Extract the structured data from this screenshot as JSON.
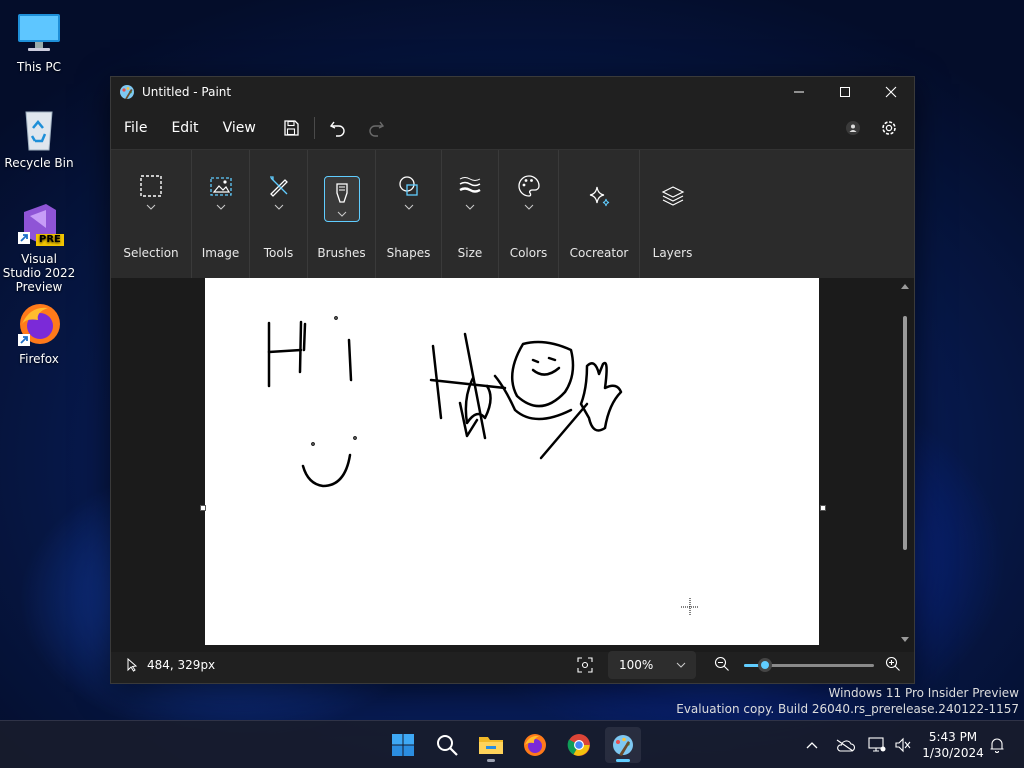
{
  "desktop": {
    "icons": [
      {
        "label": "This PC"
      },
      {
        "label": "Recycle Bin"
      },
      {
        "label": "Visual Studio 2022 Preview",
        "badge": "PRE"
      },
      {
        "label": "Firefox"
      }
    ]
  },
  "window": {
    "title": "Untitled - Paint"
  },
  "menu": {
    "items": [
      "File",
      "Edit",
      "View"
    ]
  },
  "ribbon": {
    "groups": [
      {
        "label": "Selection",
        "icon": "selection-icon"
      },
      {
        "label": "Image",
        "icon": "image-icon"
      },
      {
        "label": "Tools",
        "icon": "tools-icon"
      },
      {
        "label": "Brushes",
        "icon": "brush-icon"
      },
      {
        "label": "Shapes",
        "icon": "shapes-icon"
      },
      {
        "label": "Size",
        "icon": "size-icon"
      },
      {
        "label": "Colors",
        "icon": "palette-icon"
      },
      {
        "label": "Cocreator",
        "icon": "sparkle-icon"
      },
      {
        "label": "Layers",
        "icon": "layers-icon"
      }
    ]
  },
  "status": {
    "cursor_position": "484, 329px",
    "zoom": "100%",
    "zoom_slider_fraction": 0.16
  },
  "watermark": {
    "line1": "Windows 11 Pro Insider Preview",
    "line2": "Evaluation copy. Build 26040.rs_prerelease.240122-1157"
  },
  "clock": {
    "time": "5:43 PM",
    "date": "1/30/2024"
  },
  "colors": {
    "accent": "#60cdff",
    "window_bg": "#202020",
    "ribbon_bg": "#2b2b2b"
  }
}
